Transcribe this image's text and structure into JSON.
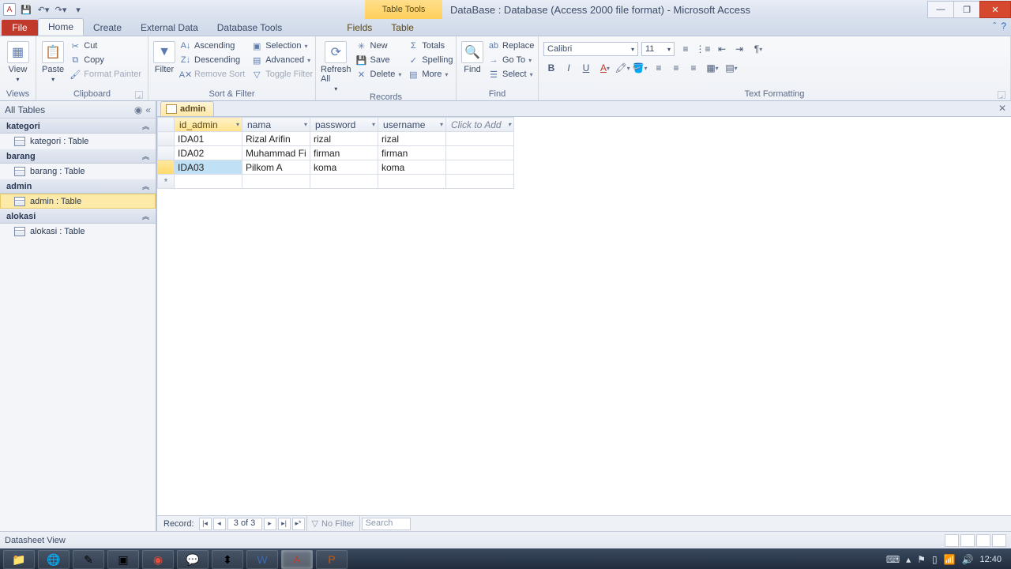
{
  "title": "DataBase : Database (Access 2000 file format)  -  Microsoft Access",
  "contextTab": "Table Tools",
  "tabs": {
    "file": "File",
    "home": "Home",
    "create": "Create",
    "external": "External Data",
    "dbtools": "Database Tools",
    "fields": "Fields",
    "table": "Table"
  },
  "ribbon": {
    "views": {
      "label": "Views",
      "view": "View"
    },
    "clipboard": {
      "label": "Clipboard",
      "paste": "Paste",
      "cut": "Cut",
      "copy": "Copy",
      "fp": "Format Painter"
    },
    "sortfilter": {
      "label": "Sort & Filter",
      "filter": "Filter",
      "asc": "Ascending",
      "desc": "Descending",
      "remove": "Remove Sort",
      "selection": "Selection",
      "advanced": "Advanced",
      "toggle": "Toggle Filter"
    },
    "records": {
      "label": "Records",
      "refresh": "Refresh All",
      "new": "New",
      "save": "Save",
      "delete": "Delete",
      "totals": "Totals",
      "spelling": "Spelling",
      "more": "More"
    },
    "find": {
      "label": "Find",
      "find": "Find",
      "replace": "Replace",
      "goto": "Go To",
      "select": "Select"
    },
    "textfmt": {
      "label": "Text Formatting",
      "font": "Calibri",
      "size": "11"
    }
  },
  "nav": {
    "header": "All Tables",
    "groups": [
      {
        "name": "kategori",
        "items": [
          "kategori : Table"
        ]
      },
      {
        "name": "barang",
        "items": [
          "barang : Table"
        ]
      },
      {
        "name": "admin",
        "items": [
          "admin : Table"
        ],
        "selected": true
      },
      {
        "name": "alokasi",
        "items": [
          "alokasi : Table"
        ]
      }
    ]
  },
  "doc": {
    "tab": "admin",
    "columns": [
      "id_admin",
      "nama",
      "password",
      "username"
    ],
    "addcol": "Click to Add",
    "rows": [
      {
        "id_admin": "IDA01",
        "nama": "Rizal Arifin",
        "password": "rizal",
        "username": "rizal"
      },
      {
        "id_admin": "IDA02",
        "nama": "Muhammad Fi",
        "password": "firman",
        "username": "firman"
      },
      {
        "id_admin": "IDA03",
        "nama": "Pilkom A",
        "password": "koma",
        "username": "koma",
        "selected": true
      }
    ],
    "recordnav": {
      "label": "Record:",
      "pos": "3 of 3",
      "nofilter": "No Filter",
      "search": "Search"
    }
  },
  "status": "Datasheet View",
  "tray": {
    "time": "12:40"
  }
}
